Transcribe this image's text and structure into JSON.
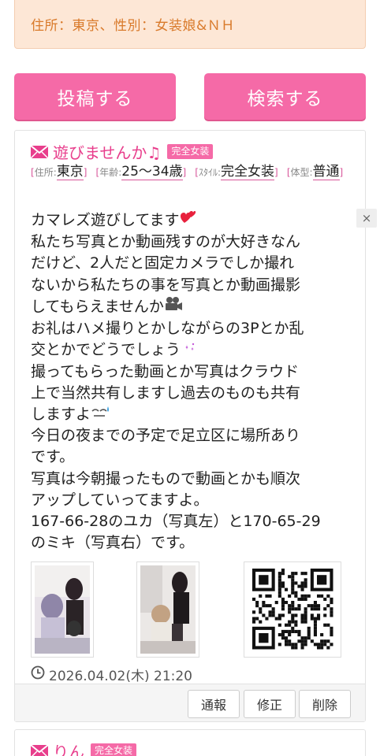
{
  "filter": {
    "text": "住所：東京、性別：女装娘&ＮＨ"
  },
  "actions": {
    "post_label": "投稿する",
    "search_label": "検索する"
  },
  "post": {
    "title": "遊びませんか♫",
    "badge": "完全女装",
    "tags": [
      {
        "label": "住所:",
        "value": "東京"
      },
      {
        "label": "年齢:",
        "value": "25〜34歳"
      },
      {
        "label": "ｽﾀｲﾙ:",
        "value": "完全女装"
      },
      {
        "label": "体型:",
        "value": "普通"
      }
    ],
    "body_lines": [
      "カマレズ遊びしてます",
      "私たち写真とか動画残すのが大好きなん",
      "だけど、2人だと固定カメラでしか撮れ",
      "ないから私たちの事を写真とか動画撮影",
      "してもらえませんか",
      "お礼はハメ撮りとかしながらの3Pとか乱",
      "交とかでどうでしょう",
      "撮ってもらった動画とか写真はクラウド",
      "上で当然共有しますし過去のものも共有",
      "しますよ",
      "今日の夜までの予定で足立区に場所あり",
      "です。",
      "写真は今朝撮ったもので動画とかも順次",
      "アップしていってますよ。",
      "167-66-28のユカ（写真左）と170-65-29",
      "のミキ（写真右）です。"
    ],
    "timestamp": "2026.04.02(木) 21:20",
    "buttons": {
      "report": "通報",
      "edit": "修正",
      "delete": "削除"
    }
  },
  "close_label": "×",
  "next_post": {
    "title": "りん",
    "badge": "完全女装"
  },
  "colors": {
    "accent_pink": "#f56aa7",
    "title_pink": "#e83e8c",
    "filter_bg": "#fde7d6",
    "filter_text": "#d97a2b"
  },
  "icons": [
    "mail-icon",
    "heart-icon",
    "film-camera-icon",
    "sparkle-icon",
    "sweat-icon",
    "clock-icon",
    "qr-code"
  ]
}
